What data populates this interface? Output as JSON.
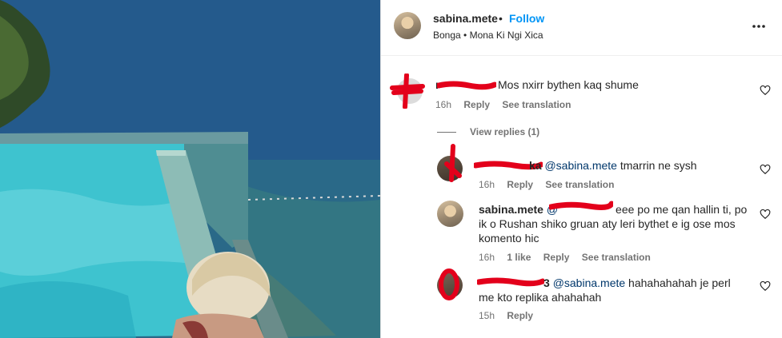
{
  "header": {
    "username": "sabina.mete",
    "separator": "•",
    "follow_label": "Follow",
    "location": "Bonga • Mona Ki Ngi Xica"
  },
  "comments": [
    {
      "username_redacted": "r",
      "text": "Mos nxirr bythen kaq shume",
      "time": "16h",
      "reply_label": "Reply",
      "translation_label": "See translation",
      "view_replies_label": "View replies (1)"
    },
    {
      "username_suffix": "ka",
      "mention": "@sabina.mete",
      "text": " tmarrin ne sysh",
      "time": "16h",
      "reply_label": "Reply",
      "translation_label": "See translation"
    },
    {
      "username": "sabina.mete",
      "mention_prefix": "@",
      "text_line1": "eee po me qan hallin ti, po",
      "text_line2": "ik o Rushan shiko gruan aty leri bythet e ig ose mos",
      "text_line3": "komento hic",
      "time": "16h",
      "likes": "1 like",
      "reply_label": "Reply",
      "translation_label": "See translation"
    },
    {
      "username_suffix": "3",
      "mention": "@sabina.mete",
      "text_line1": " hahahahahah je perl",
      "text_line2": "me kto replika ahahahah",
      "time": "15h",
      "reply_label": "Reply"
    }
  ],
  "colors": {
    "accent": "#0095f6",
    "mention": "#00376b",
    "redaction": "#e3001b",
    "meta": "#737373"
  }
}
